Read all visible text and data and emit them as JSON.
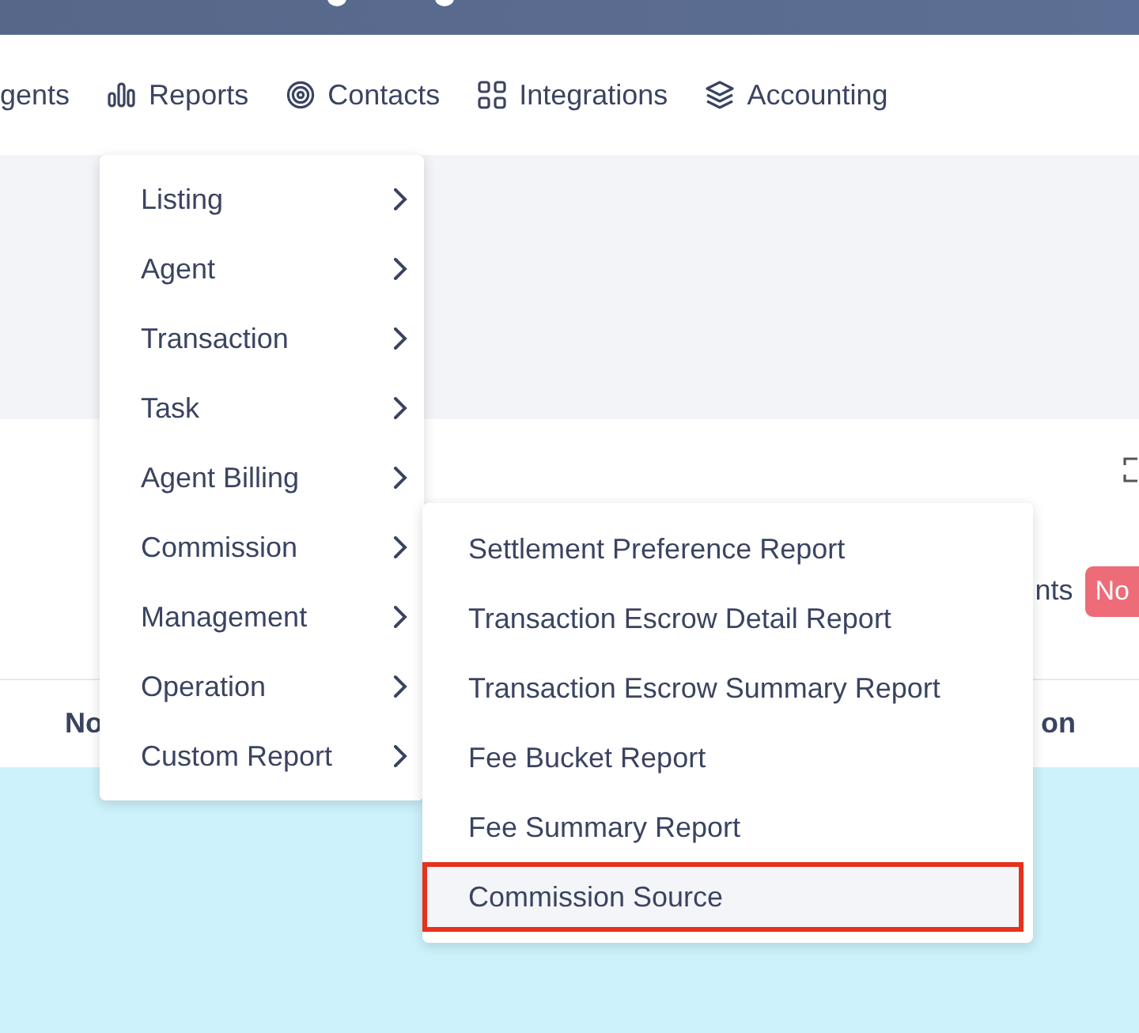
{
  "nav": {
    "items": [
      {
        "label": "gents"
      },
      {
        "label": "Reports"
      },
      {
        "label": "Contacts"
      },
      {
        "label": "Integrations"
      },
      {
        "label": "Accounting"
      }
    ]
  },
  "menu": {
    "items": [
      {
        "label": "Listing"
      },
      {
        "label": "Agent"
      },
      {
        "label": "Transaction"
      },
      {
        "label": "Task"
      },
      {
        "label": "Agent Billing"
      },
      {
        "label": "Commission"
      },
      {
        "label": "Management"
      },
      {
        "label": "Operation"
      },
      {
        "label": "Custom Report"
      }
    ]
  },
  "submenu": {
    "items": [
      {
        "label": "Settlement Preference Report",
        "selected": false
      },
      {
        "label": "Transaction Escrow Detail Report",
        "selected": false
      },
      {
        "label": "Transaction Escrow Summary Report",
        "selected": false
      },
      {
        "label": "Fee Bucket Report",
        "selected": false
      },
      {
        "label": "Fee Summary Report",
        "selected": false
      },
      {
        "label": "Commission Source",
        "selected": true
      }
    ]
  },
  "panel": {
    "label": "nts",
    "badge": "No"
  },
  "table": {
    "columns": [
      "No",
      "on"
    ]
  }
}
